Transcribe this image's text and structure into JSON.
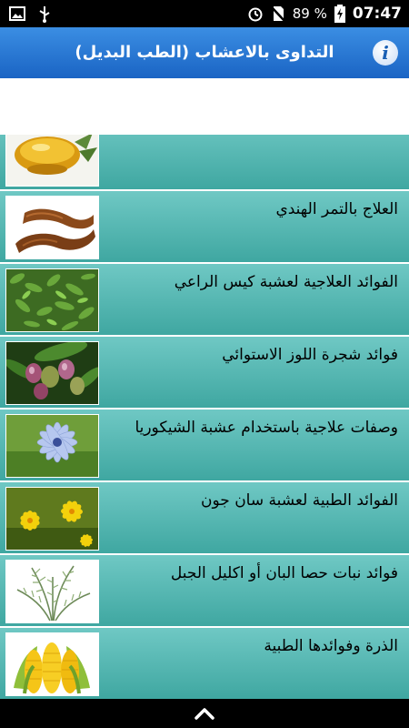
{
  "status": {
    "battery": "89 %",
    "time": "07:47"
  },
  "app": {
    "title": "التداوى بالاعشاب (الطب البديل)",
    "info_glyph": "i"
  },
  "items": [
    {
      "label": "",
      "image": "oil-bowl"
    },
    {
      "label": "العلاج بالتمر الهندي",
      "image": "tamarind"
    },
    {
      "label": "الفوائد العلاجية لعشبة كيس الراعي",
      "image": "shepherds-purse"
    },
    {
      "label": "فوائد شجرة اللوز الاستوائي",
      "image": "tropical-almond"
    },
    {
      "label": "وصفات علاجية باستخدام عشبة الشيكوريا",
      "image": "chicory-flower"
    },
    {
      "label": "الفوائد الطبية لعشبة سان جون",
      "image": "st-johns-wort"
    },
    {
      "label": "فوائد نبات حصا البان أو اكليل الجبل",
      "image": "rosemary"
    },
    {
      "label": "الذرة وفوائدها الطبية",
      "image": "corn"
    }
  ],
  "nav": {
    "up_icon": "chevron-up-icon"
  }
}
